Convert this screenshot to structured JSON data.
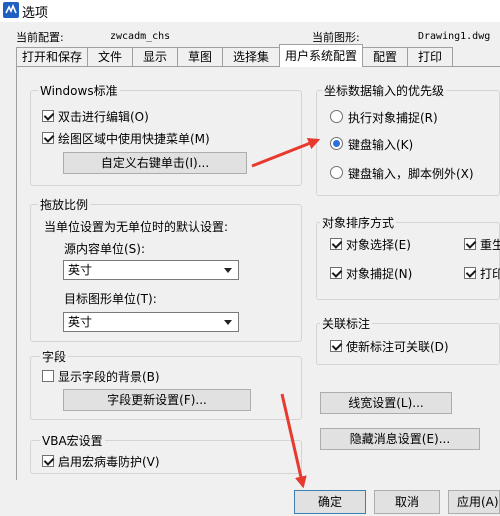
{
  "window": {
    "title": "选项"
  },
  "info": {
    "current_profile_label": "当前配置:",
    "current_profile_value": "zwcadm_chs",
    "current_drawing_label": "当前图形:",
    "current_drawing_value": "Drawing1.dwg"
  },
  "tabs": [
    "打开和保存",
    "文件",
    "显示",
    "草图",
    "选择集",
    "用户系统配置",
    "配置",
    "打印"
  ],
  "active_tab": "用户系统配置",
  "windows_std": {
    "title": "Windows标准",
    "double_click_edit": {
      "label": "双击进行编辑(O)",
      "checked": true
    },
    "shortcut_menu": {
      "label": "绘图区域中使用快捷菜单(M)",
      "checked": true
    },
    "custom_right_click_button": "自定义右键单击(I)..."
  },
  "coord_priority": {
    "title": "坐标数据输入的优先级",
    "options": [
      {
        "label": "执行对象捕捉(R)",
        "selected": false
      },
      {
        "label": "键盘输入(K)",
        "selected": true
      },
      {
        "label": "键盘输入，脚本例外(X)",
        "selected": false
      }
    ]
  },
  "drag_scale": {
    "title": "拖放比例",
    "description": "当单位设置为无单位时的默认设置:",
    "source_label": "源内容单位(S):",
    "source_value": "英寸",
    "target_label": "目标图形单位(T):",
    "target_value": "英寸"
  },
  "object_sort": {
    "title": "对象排序方式",
    "items": [
      {
        "label": "对象选择(E)",
        "checked": true
      },
      {
        "label": "重生",
        "checked": true
      },
      {
        "label": "对象捕捉(N)",
        "checked": true
      },
      {
        "label": "打印",
        "checked": true
      }
    ]
  },
  "assoc_dim": {
    "title": "关联标注",
    "new_assoc": {
      "label": "使新标注可关联(D)",
      "checked": true
    }
  },
  "field": {
    "title": "字段",
    "show_background": {
      "label": "显示字段的背景(B)",
      "checked": false
    },
    "update_settings_button": "字段更新设置(F)..."
  },
  "lineweight_button": "线宽设置(L)...",
  "hidden_msg_button": "隐藏消息设置(E)...",
  "vba": {
    "title": "VBA宏设置",
    "virus_protect": {
      "label": "启用宏病毒防护(V)",
      "checked": true
    }
  },
  "footer": {
    "ok": "确定",
    "cancel": "取消",
    "apply": "应用(A)"
  },
  "colors": {
    "arrow": "#e8392e",
    "accent": "#2a6fdb"
  }
}
